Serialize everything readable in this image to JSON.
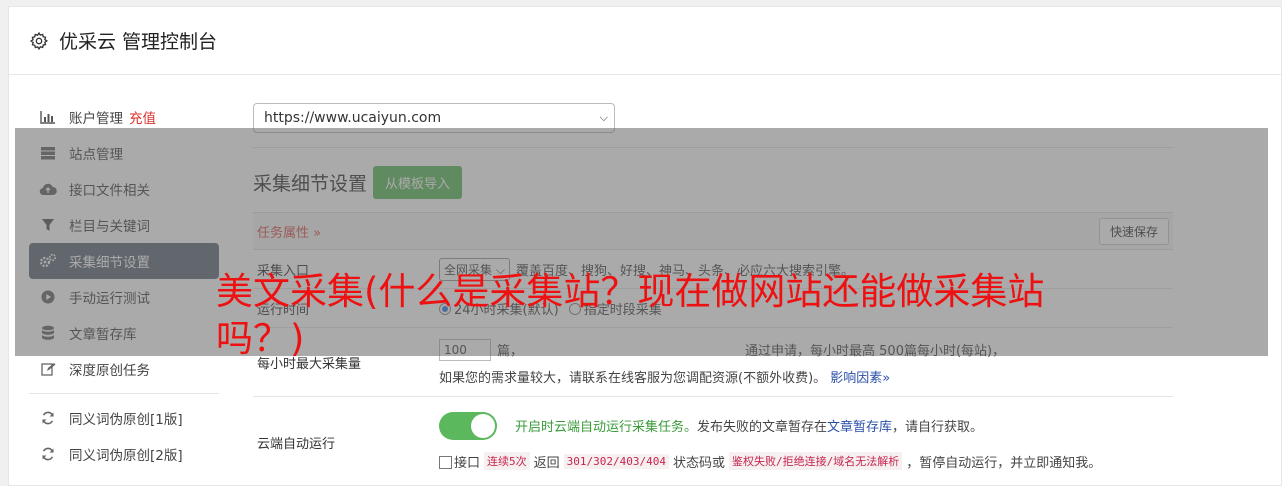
{
  "header": {
    "title": "优采云 管理控制台",
    "icon": "gear-icon"
  },
  "sidebar": {
    "items": [
      {
        "label": "账户管理",
        "extra": "充值",
        "icon": "bar-chart-icon"
      },
      {
        "label": "站点管理",
        "icon": "server-icon"
      },
      {
        "label": "接口文件相关",
        "icon": "cloud-upload-icon"
      },
      {
        "label": "栏目与关键词",
        "icon": "filter-icon"
      },
      {
        "label": "采集细节设置",
        "icon": "gears-icon"
      },
      {
        "label": "手动运行测试",
        "icon": "play-icon"
      },
      {
        "label": "文章暂存库",
        "icon": "database-icon"
      },
      {
        "label": "深度原创任务",
        "icon": "edit-icon"
      },
      {
        "label": "同义词伪原创[1版]",
        "icon": "refresh-icon"
      },
      {
        "label": "同义词伪原创[2版]",
        "icon": "refresh-icon"
      }
    ]
  },
  "main": {
    "site_select": "https://www.ucaiyun.com",
    "section_title": "采集细节设置",
    "import_button": "从模板导入",
    "tab_label": "任务属性 »",
    "quick_save": "快速保存",
    "rows": {
      "entry": {
        "label": "采集入口",
        "select": "全网采集",
        "desc": "覆盖百度、搜狗、好搜、神马、头条、必应六大搜索引擎。"
      },
      "runtime": {
        "label": "运行时间",
        "opt1": "24小时采集(默认)",
        "opt2": "指定时段采集"
      },
      "max": {
        "label": "每小时最大采集量",
        "value": "100",
        "desc_start": "篇，",
        "desc_end": "通过申请，每小时最高 500篇每小时(每站)，",
        "desc2": "如果您的需求量较大，请联系在线客服为您调配资源(不额外收费)。",
        "link": "影响因素»"
      },
      "cloud": {
        "label": "云端自动运行",
        "toggle_on": true,
        "text1_green": "开启时云端自动运行采集任务。",
        "text1": "发布失败的文章暂存在",
        "text1_link": "文章暂存库",
        "text1_end": "，请自行获取。",
        "check_text": "接口",
        "code1": "连续5次",
        "t2": "返回",
        "code2": "301/302/403/404",
        "t3": "状态码或",
        "code3": "鉴权失败/拒绝连接/域名无法解析",
        "t4": "，暂停自动运行，并立即通知我。"
      }
    }
  },
  "caption": "美文采集(什么是采集站？现在做网站还能做采集站吗？)",
  "colors": {
    "caption": "#ee1111",
    "active_nav": "#5f6b7a",
    "green": "#5cb85c",
    "accent_red": "#d9312c"
  }
}
